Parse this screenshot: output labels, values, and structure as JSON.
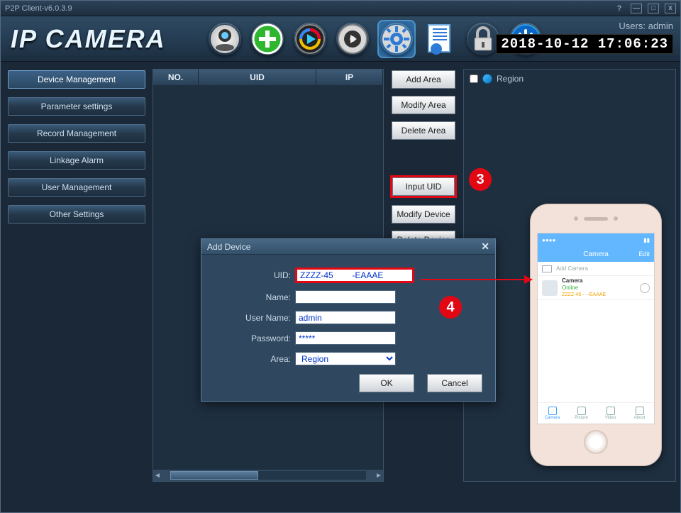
{
  "title_bar": {
    "app_title": "P2P Client-v6.0.3.9"
  },
  "header": {
    "logo_text": "IP CAMERA",
    "users_label": "Users: admin",
    "clock": "2018-10-12 17:06:23"
  },
  "sidebar": {
    "items": [
      "Device Management",
      "Parameter settings",
      "Record Management",
      "Linkage Alarm",
      "User Management",
      "Other Settings"
    ]
  },
  "list_headers": {
    "no": "NO.",
    "uid": "UID",
    "ip": "IP"
  },
  "action_buttons": {
    "add_area": "Add Area",
    "modify_area": "Modify Area",
    "delete_area": "Delete Area",
    "input_uid": "Input UID",
    "modify_device": "Modify Device",
    "delete_device": "Delete Device"
  },
  "tree": {
    "root": "Region"
  },
  "dialog": {
    "title": "Add Device",
    "labels": {
      "uid": "UID:",
      "name": "Name:",
      "user": "User Name:",
      "pass": "Password:",
      "area": "Area:"
    },
    "values": {
      "uid": "ZZZZ-45        -EAAAE",
      "name": "",
      "user": "admin",
      "pass": "*****",
      "area": "Region"
    },
    "buttons": {
      "ok": "OK",
      "cancel": "Cancel"
    }
  },
  "callouts": {
    "c3": "3",
    "c4": "4"
  },
  "phone": {
    "appbar_title": "Camera",
    "appbar_edit": "Edit",
    "add_camera": "Add Camera",
    "cam_name": "Camera",
    "cam_status": "Online",
    "cam_uid": "ZZZZ-45····-EAAAE",
    "tabs": [
      "Camera",
      "Picture",
      "Video",
      "About"
    ]
  }
}
